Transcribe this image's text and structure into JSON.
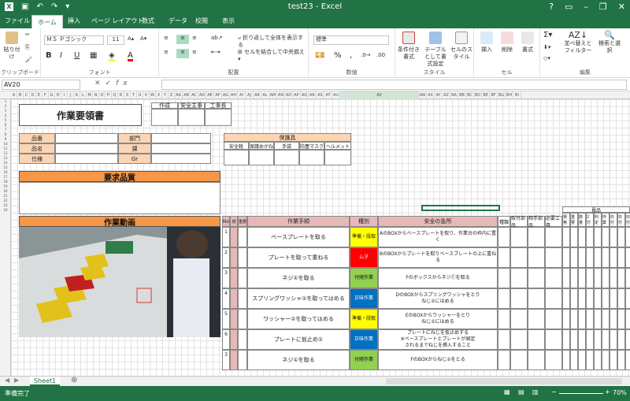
{
  "titlebar": {
    "title": "test23 - Excel",
    "help": "?",
    "minimize": "–",
    "restore": "❐",
    "close": "✕"
  },
  "tabs": [
    "ファイル",
    "ホーム",
    "挿入",
    "ページ レイアウト",
    "数式",
    "データ",
    "校閲",
    "表示"
  ],
  "ribbon": {
    "clipboard": {
      "paste": "貼り付け",
      "label": "クリップボード"
    },
    "font": {
      "name": "ＭＳ Ｐゴシック",
      "size": "11",
      "label": "フォント"
    },
    "alignment": {
      "wrap": "折り返して全体を表示する",
      "merge": "セルを結合して中央揃え",
      "label": "配置"
    },
    "number": {
      "format": "標準",
      "label": "数値"
    },
    "styles": {
      "conditional": "条件付き書式",
      "table": "テーブルとして書式設定",
      "cell": "セルのスタイル",
      "label": "スタイル"
    },
    "cells": {
      "insert": "挿入",
      "delete": "削除",
      "format": "書式",
      "label": "セル"
    },
    "editing": {
      "sort": "並べ替えとフィルター",
      "find": "検索と選択",
      "label": "編集"
    }
  },
  "formula_bar": {
    "name_box": "AV20",
    "value": ""
  },
  "column_headers": [
    "A",
    "B",
    "C",
    "D",
    "E",
    "F",
    "G",
    "H",
    "I",
    "J",
    "K",
    "L",
    "M",
    "N",
    "O",
    "P",
    "Q",
    "R",
    "S",
    "T",
    "U",
    "V",
    "W",
    "X",
    "Y",
    "Z",
    "AA",
    "AB",
    "AC",
    "AD",
    "AE",
    "AF",
    "AG",
    "AH",
    "AI",
    "AJ",
    "AK",
    "AL",
    "AM",
    "AN",
    "AO",
    "AP",
    "AQ",
    "AR",
    "AS",
    "AT",
    "AU",
    "AV",
    "AW",
    "AX",
    "AY",
    "AZ",
    "BA",
    "BB",
    "BC",
    "BD",
    "BE",
    "BF",
    "BG",
    "BH",
    "BI"
  ],
  "sheet": {
    "title": "作業要領書",
    "approvals": [
      "作成",
      "安全主事",
      "工事長"
    ],
    "info_labels": [
      "品番",
      "品名",
      "仕様"
    ],
    "info_labels2": [
      "部門",
      "課",
      "Gr"
    ],
    "protective": {
      "header": "保護具",
      "items": [
        "安全靴",
        "保護めがね",
        "手袋",
        "防塵マスク",
        "ヘルメット"
      ]
    },
    "quality_header": "要求品質",
    "video_header": "作業動画",
    "table_headers": {
      "no": "No",
      "c2": "頻",
      "c3": "重要",
      "step": "作業手順",
      "kind": "種別",
      "safety": "安全の急所",
      "c7": "種類",
      "c8": "取付部品",
      "c9": "相手部品",
      "c10": "必要工具",
      "parts_group": "員品",
      "sub": [
        "規格",
        "重要",
        "数量",
        "2付",
        "判定",
        "作業",
        "日付",
        "日付",
        "日付"
      ]
    },
    "rows": [
      {
        "no": "1",
        "step": "ベースプレートを取る",
        "kind": "準備・段取",
        "safety": "AのBOXからベースプレートを取り、作業台の枠内に置く"
      },
      {
        "no": "2",
        "step": "プレートを取って重ねる",
        "kind": "ムダ",
        "safety": "BのBOXからプレートを取りベースプレートの上に重ねる"
      },
      {
        "no": "3",
        "step": "ネジ①を取る",
        "kind": "付随作業",
        "safety": "FのボックスからネジⒸを取る"
      },
      {
        "no": "4",
        "step": "スプリングワッシャ①を取ってはめる",
        "kind": "正味作業",
        "safety": "DのBOXからスプリングワッシャをとり\nねじ①にはめる"
      },
      {
        "no": "5",
        "step": "ワッシャー①を取ってはめる",
        "kind": "準備・段取",
        "safety": "EのBOXからワッシャーをとり\nねじ①にはめる"
      },
      {
        "no": "6",
        "step": "プレートに仮止め①",
        "kind": "正味作業",
        "safety": "プレートにねじを仮止めする\n※ベースプレートとプレートが固定\nされるまでねじを挿入すること"
      },
      {
        "no": "3",
        "step": "ネジ①を取る",
        "kind": "付随作業",
        "safety": "FのBOXからねじ①をとる"
      }
    ]
  },
  "sheet_tab": "Sheet1",
  "status": {
    "left": "準備完了",
    "zoom": "70%"
  },
  "colors": {
    "excel_green": "#217346",
    "orange": "#f79646",
    "peach": "#fbd5b5",
    "pink": "#e6b9b8",
    "yellow": "#ffff00",
    "red": "#ff0000",
    "green": "#92d050",
    "blue": "#0070c0"
  }
}
